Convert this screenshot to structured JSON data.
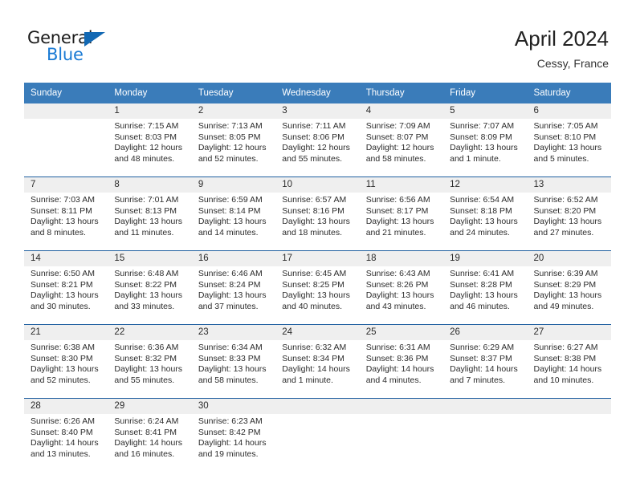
{
  "brand": {
    "name_top": "General",
    "name_bottom": "Blue",
    "triangle_color": "#1268b3",
    "blue_text_color": "#1a7ad4"
  },
  "header": {
    "title": "April 2024",
    "location": "Cessy, France"
  },
  "theme": {
    "header_bg": "#3a7cba",
    "day_band_bg": "#efefef",
    "week_separator": "#1f5fa0",
    "cell_bg": "#ffffff",
    "text": "#2b2b2b"
  },
  "weekday_headers": [
    "Sunday",
    "Monday",
    "Tuesday",
    "Wednesday",
    "Thursday",
    "Friday",
    "Saturday"
  ],
  "weeks": [
    [
      {
        "day": "",
        "lines": [
          "",
          "",
          "",
          ""
        ]
      },
      {
        "day": "1",
        "lines": [
          "Sunrise: 7:15 AM",
          "Sunset: 8:03 PM",
          "Daylight: 12 hours",
          "and 48 minutes."
        ]
      },
      {
        "day": "2",
        "lines": [
          "Sunrise: 7:13 AM",
          "Sunset: 8:05 PM",
          "Daylight: 12 hours",
          "and 52 minutes."
        ]
      },
      {
        "day": "3",
        "lines": [
          "Sunrise: 7:11 AM",
          "Sunset: 8:06 PM",
          "Daylight: 12 hours",
          "and 55 minutes."
        ]
      },
      {
        "day": "4",
        "lines": [
          "Sunrise: 7:09 AM",
          "Sunset: 8:07 PM",
          "Daylight: 12 hours",
          "and 58 minutes."
        ]
      },
      {
        "day": "5",
        "lines": [
          "Sunrise: 7:07 AM",
          "Sunset: 8:09 PM",
          "Daylight: 13 hours",
          "and 1 minute."
        ]
      },
      {
        "day": "6",
        "lines": [
          "Sunrise: 7:05 AM",
          "Sunset: 8:10 PM",
          "Daylight: 13 hours",
          "and 5 minutes."
        ]
      }
    ],
    [
      {
        "day": "7",
        "lines": [
          "Sunrise: 7:03 AM",
          "Sunset: 8:11 PM",
          "Daylight: 13 hours",
          "and 8 minutes."
        ]
      },
      {
        "day": "8",
        "lines": [
          "Sunrise: 7:01 AM",
          "Sunset: 8:13 PM",
          "Daylight: 13 hours",
          "and 11 minutes."
        ]
      },
      {
        "day": "9",
        "lines": [
          "Sunrise: 6:59 AM",
          "Sunset: 8:14 PM",
          "Daylight: 13 hours",
          "and 14 minutes."
        ]
      },
      {
        "day": "10",
        "lines": [
          "Sunrise: 6:57 AM",
          "Sunset: 8:16 PM",
          "Daylight: 13 hours",
          "and 18 minutes."
        ]
      },
      {
        "day": "11",
        "lines": [
          "Sunrise: 6:56 AM",
          "Sunset: 8:17 PM",
          "Daylight: 13 hours",
          "and 21 minutes."
        ]
      },
      {
        "day": "12",
        "lines": [
          "Sunrise: 6:54 AM",
          "Sunset: 8:18 PM",
          "Daylight: 13 hours",
          "and 24 minutes."
        ]
      },
      {
        "day": "13",
        "lines": [
          "Sunrise: 6:52 AM",
          "Sunset: 8:20 PM",
          "Daylight: 13 hours",
          "and 27 minutes."
        ]
      }
    ],
    [
      {
        "day": "14",
        "lines": [
          "Sunrise: 6:50 AM",
          "Sunset: 8:21 PM",
          "Daylight: 13 hours",
          "and 30 minutes."
        ]
      },
      {
        "day": "15",
        "lines": [
          "Sunrise: 6:48 AM",
          "Sunset: 8:22 PM",
          "Daylight: 13 hours",
          "and 33 minutes."
        ]
      },
      {
        "day": "16",
        "lines": [
          "Sunrise: 6:46 AM",
          "Sunset: 8:24 PM",
          "Daylight: 13 hours",
          "and 37 minutes."
        ]
      },
      {
        "day": "17",
        "lines": [
          "Sunrise: 6:45 AM",
          "Sunset: 8:25 PM",
          "Daylight: 13 hours",
          "and 40 minutes."
        ]
      },
      {
        "day": "18",
        "lines": [
          "Sunrise: 6:43 AM",
          "Sunset: 8:26 PM",
          "Daylight: 13 hours",
          "and 43 minutes."
        ]
      },
      {
        "day": "19",
        "lines": [
          "Sunrise: 6:41 AM",
          "Sunset: 8:28 PM",
          "Daylight: 13 hours",
          "and 46 minutes."
        ]
      },
      {
        "day": "20",
        "lines": [
          "Sunrise: 6:39 AM",
          "Sunset: 8:29 PM",
          "Daylight: 13 hours",
          "and 49 minutes."
        ]
      }
    ],
    [
      {
        "day": "21",
        "lines": [
          "Sunrise: 6:38 AM",
          "Sunset: 8:30 PM",
          "Daylight: 13 hours",
          "and 52 minutes."
        ]
      },
      {
        "day": "22",
        "lines": [
          "Sunrise: 6:36 AM",
          "Sunset: 8:32 PM",
          "Daylight: 13 hours",
          "and 55 minutes."
        ]
      },
      {
        "day": "23",
        "lines": [
          "Sunrise: 6:34 AM",
          "Sunset: 8:33 PM",
          "Daylight: 13 hours",
          "and 58 minutes."
        ]
      },
      {
        "day": "24",
        "lines": [
          "Sunrise: 6:32 AM",
          "Sunset: 8:34 PM",
          "Daylight: 14 hours",
          "and 1 minute."
        ]
      },
      {
        "day": "25",
        "lines": [
          "Sunrise: 6:31 AM",
          "Sunset: 8:36 PM",
          "Daylight: 14 hours",
          "and 4 minutes."
        ]
      },
      {
        "day": "26",
        "lines": [
          "Sunrise: 6:29 AM",
          "Sunset: 8:37 PM",
          "Daylight: 14 hours",
          "and 7 minutes."
        ]
      },
      {
        "day": "27",
        "lines": [
          "Sunrise: 6:27 AM",
          "Sunset: 8:38 PM",
          "Daylight: 14 hours",
          "and 10 minutes."
        ]
      }
    ],
    [
      {
        "day": "28",
        "lines": [
          "Sunrise: 6:26 AM",
          "Sunset: 8:40 PM",
          "Daylight: 14 hours",
          "and 13 minutes."
        ]
      },
      {
        "day": "29",
        "lines": [
          "Sunrise: 6:24 AM",
          "Sunset: 8:41 PM",
          "Daylight: 14 hours",
          "and 16 minutes."
        ]
      },
      {
        "day": "30",
        "lines": [
          "Sunrise: 6:23 AM",
          "Sunset: 8:42 PM",
          "Daylight: 14 hours",
          "and 19 minutes."
        ]
      },
      {
        "day": "",
        "lines": [
          "",
          "",
          "",
          ""
        ]
      },
      {
        "day": "",
        "lines": [
          "",
          "",
          "",
          ""
        ]
      },
      {
        "day": "",
        "lines": [
          "",
          "",
          "",
          ""
        ]
      },
      {
        "day": "",
        "lines": [
          "",
          "",
          "",
          ""
        ]
      }
    ]
  ]
}
